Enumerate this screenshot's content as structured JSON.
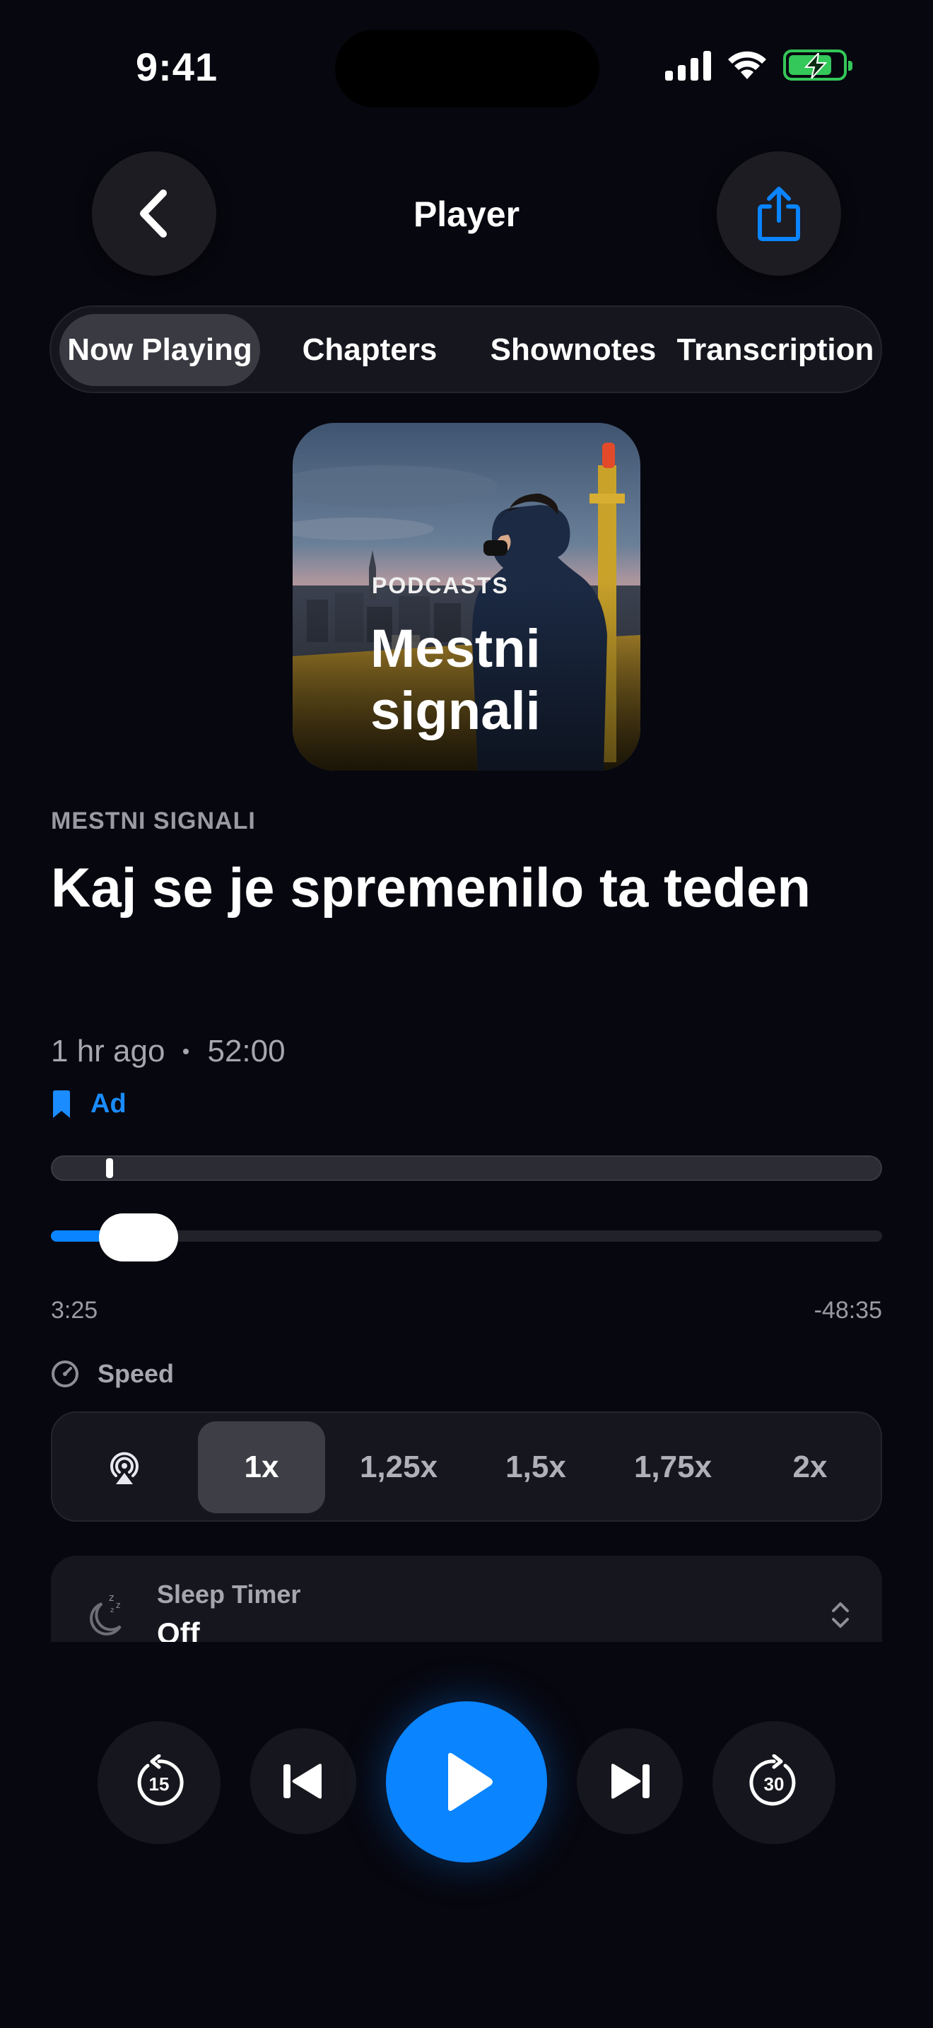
{
  "status_bar": {
    "time": "9:41"
  },
  "header": {
    "title": "Player"
  },
  "tabs": [
    {
      "label": "Now Playing",
      "active": true
    },
    {
      "label": "Chapters",
      "active": false
    },
    {
      "label": "Shownotes",
      "active": false
    },
    {
      "label": "Transcription",
      "active": false
    }
  ],
  "artwork": {
    "label": "PODCASTS",
    "title_line1": "Mestni",
    "title_line2": "signali"
  },
  "episode": {
    "show_name": "MESTNI SIGNALI",
    "title": "Kaj se je spremenilo ta teden",
    "published": "1 hr ago",
    "duration": "52:00",
    "tag": "Ad"
  },
  "progress": {
    "elapsed": "3:25",
    "remaining": "-48:35",
    "fraction": 0.066
  },
  "speed": {
    "label": "Speed",
    "options": [
      "1x",
      "1,25x",
      "1,5x",
      "1,75x",
      "2x"
    ],
    "selected": "1x"
  },
  "sleep_timer": {
    "label": "Sleep Timer",
    "value": "Off"
  },
  "controls": {
    "skip_back_seconds": "15",
    "skip_forward_seconds": "30"
  },
  "colors": {
    "accent": "#0a84ff",
    "background": "#07070f",
    "battery": "#34c759"
  }
}
